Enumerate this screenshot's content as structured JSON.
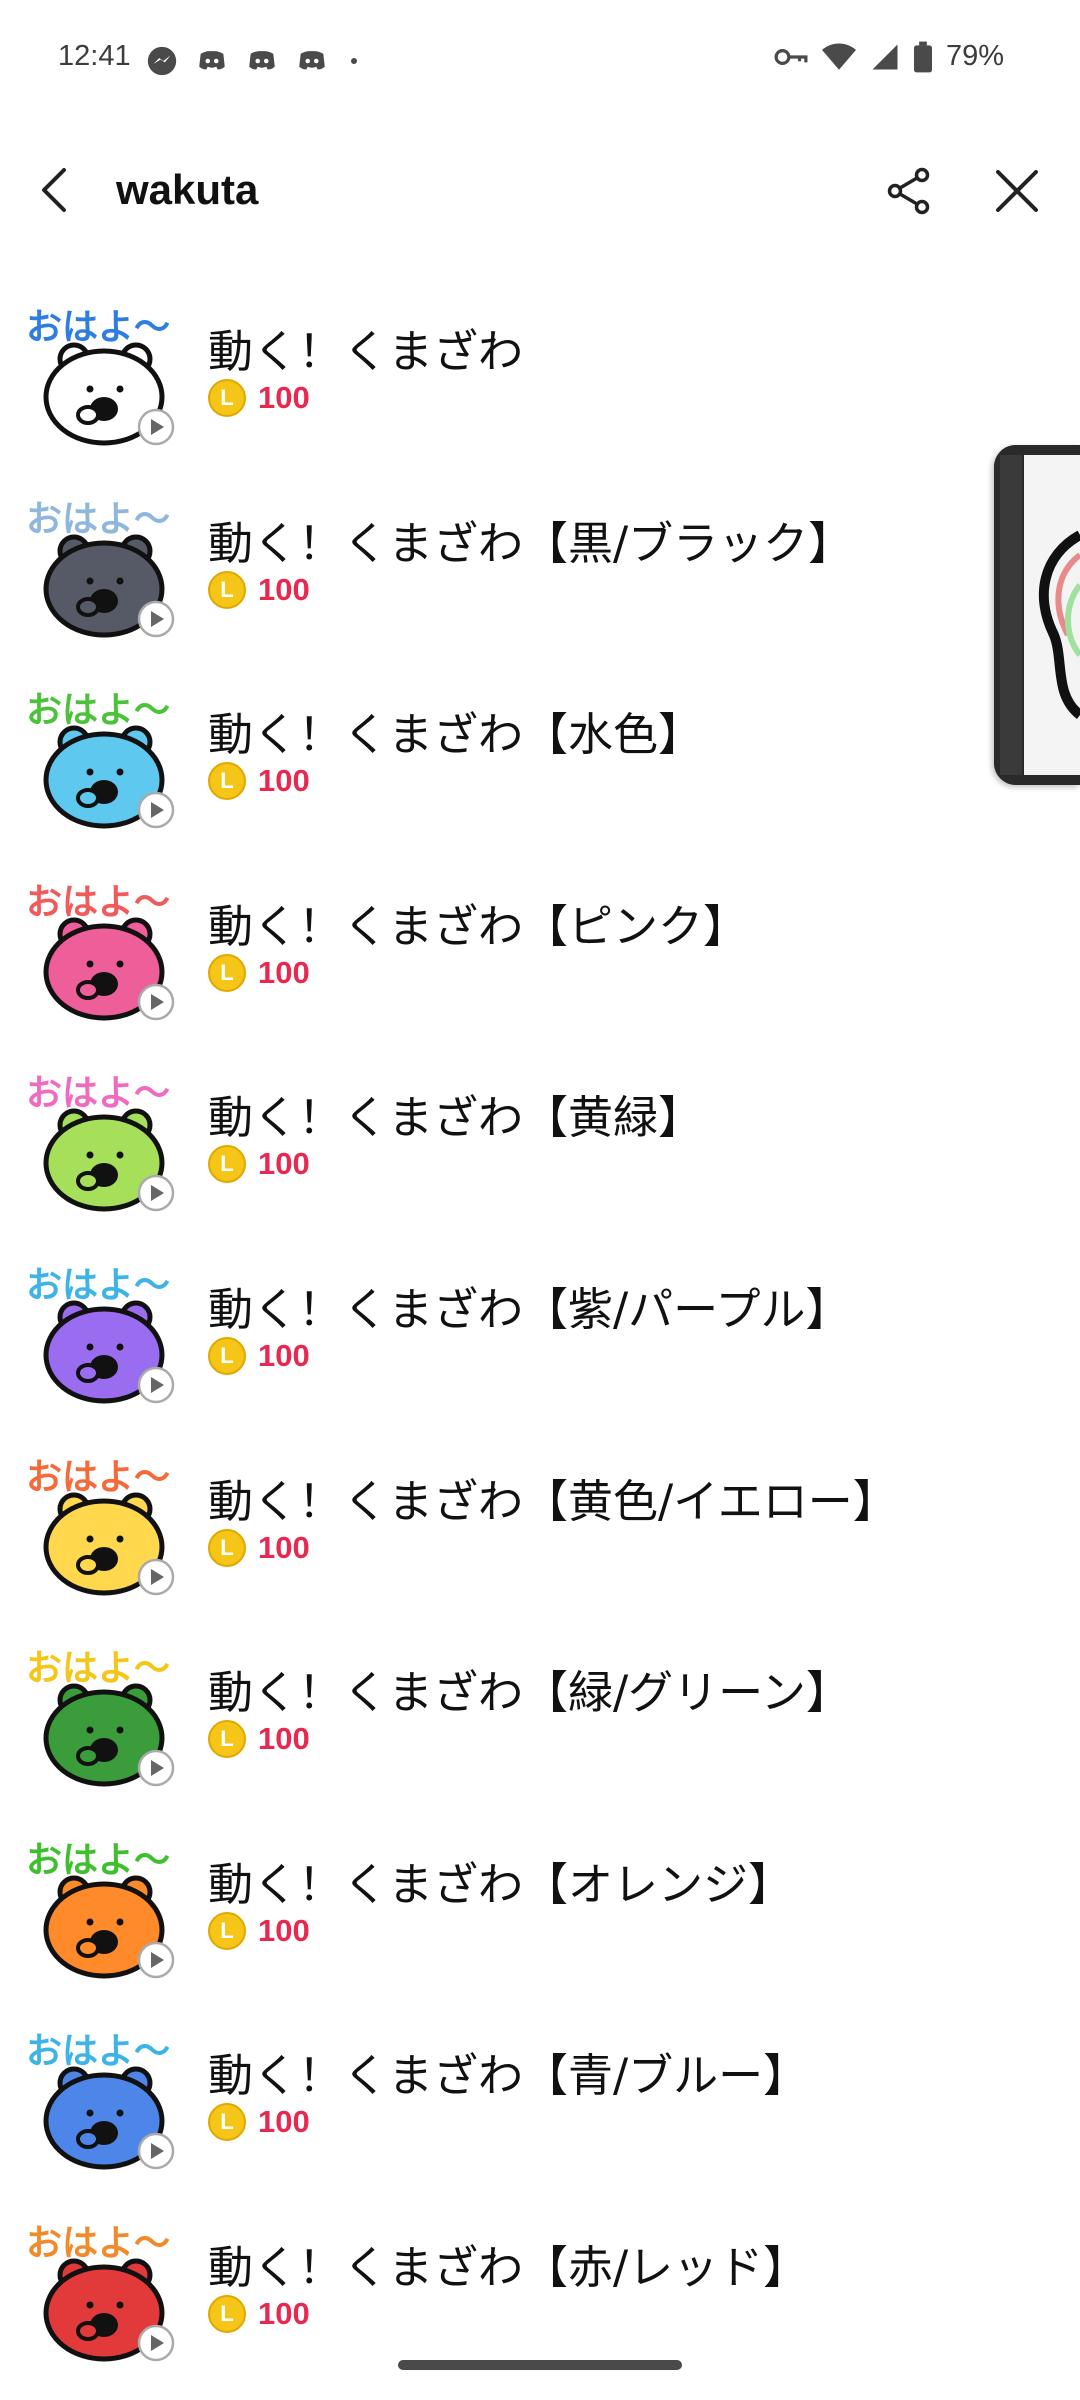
{
  "status_bar": {
    "time": "12:41",
    "battery": "79%",
    "icons": [
      "messenger-icon",
      "discord-icon",
      "discord-icon",
      "discord-icon",
      "dot-icon",
      "vpn-key-icon",
      "wifi-icon",
      "signal-icon",
      "battery-icon"
    ]
  },
  "header": {
    "title": "wakuta"
  },
  "stickers": [
    {
      "title": "動く！くまざわ",
      "price": "100",
      "color": "#ffffff",
      "greet_color": "#2f7de1"
    },
    {
      "title": "動く！くまざわ【黒/ブラック】",
      "price": "100",
      "color": "#555a66",
      "greet_color": "#8fb6dc"
    },
    {
      "title": "動く！くまざわ【水色】",
      "price": "100",
      "color": "#5fc8ee",
      "greet_color": "#4cc23a"
    },
    {
      "title": "動く！くまざわ【ピンク】",
      "price": "100",
      "color": "#ee5f9a",
      "greet_color": "#f05a5a"
    },
    {
      "title": "動く！くまざわ【黄緑】",
      "price": "100",
      "color": "#a6df5a",
      "greet_color": "#f06ac0"
    },
    {
      "title": "動く！くまざわ【紫/パープル】",
      "price": "100",
      "color": "#9a6cf0",
      "greet_color": "#3db3e6"
    },
    {
      "title": "動く！くまざわ【黄色/イエロー】",
      "price": "100",
      "color": "#ffd84e",
      "greet_color": "#f46a3a"
    },
    {
      "title": "動く！くまざわ【緑/グリーン】",
      "price": "100",
      "color": "#3a9c3a",
      "greet_color": "#f5c518"
    },
    {
      "title": "動く！くまざわ【オレンジ】",
      "price": "100",
      "color": "#ff8a2a",
      "greet_color": "#3fbf2e"
    },
    {
      "title": "動く！くまざわ【青/ブルー】",
      "price": "100",
      "color": "#4d86e8",
      "greet_color": "#3db3e6"
    },
    {
      "title": "動く！くまざわ【赤/レッド】",
      "price": "100",
      "color": "#e23a3a",
      "greet_color": "#f08a2a"
    }
  ],
  "greeting_text": "おはよ〜",
  "coin_label": "L"
}
